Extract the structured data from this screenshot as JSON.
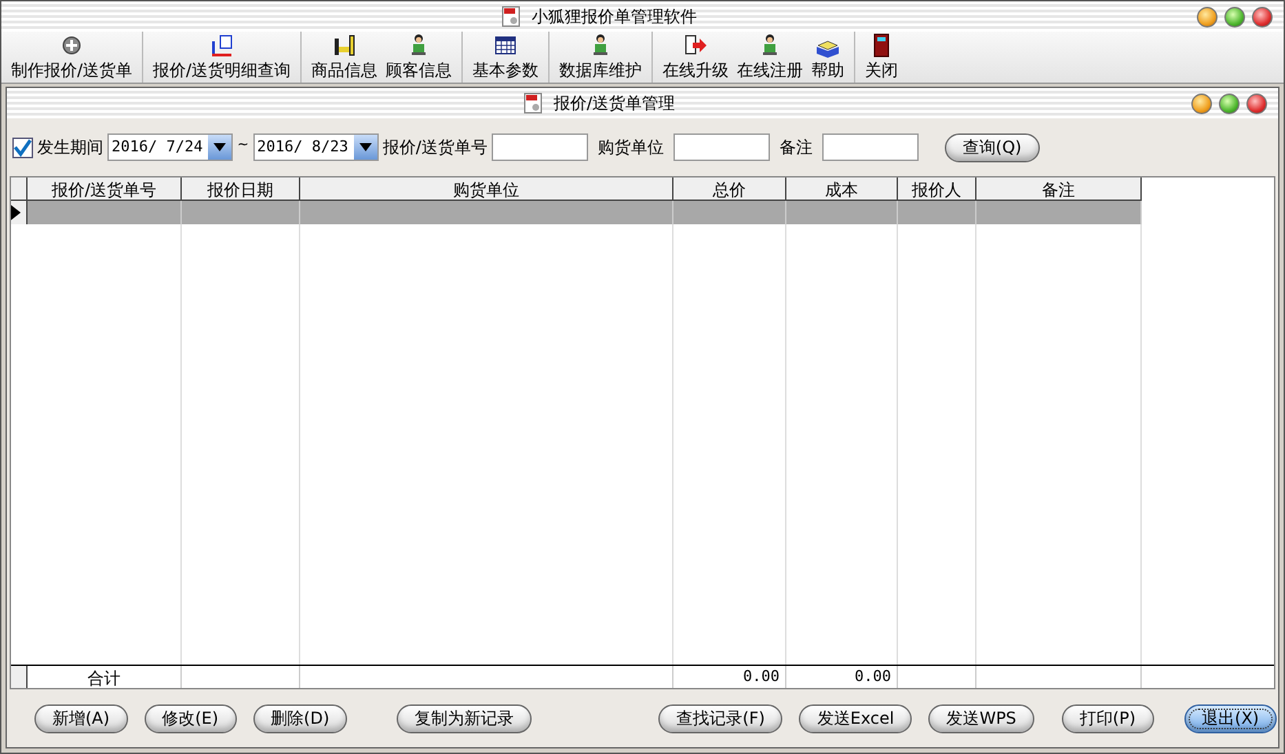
{
  "window": {
    "title": "小狐狸报价单管理软件"
  },
  "toolbar": [
    {
      "items": [
        "制作报价/送货单"
      ]
    },
    {
      "items": [
        "报价/送货明细查询"
      ]
    },
    {
      "items": [
        "商品信息",
        "顾客信息"
      ]
    },
    {
      "items": [
        "基本参数"
      ]
    },
    {
      "items": [
        "数据库维护"
      ]
    },
    {
      "items": [
        "在线升级",
        "在线注册",
        "帮助"
      ]
    },
    {
      "items": [
        "关闭"
      ]
    }
  ],
  "child_window": {
    "title": "报价/送货单管理"
  },
  "filter": {
    "period": {
      "label": "发生期间",
      "checked": true,
      "from": "2016/ 7/24",
      "separator": "~",
      "to": "2016/ 8/23"
    },
    "fields": [
      {
        "label": "报价/送货单号"
      },
      {
        "label": "购货单位"
      },
      {
        "label": "备注"
      }
    ],
    "search_button": "查询(Q)"
  },
  "table": {
    "columns": [
      "报价/送货单号",
      "报价日期",
      "购货单位",
      "总价",
      "成本",
      "报价人",
      "备注"
    ],
    "rows": [
      {
        "selected": true
      }
    ],
    "totals": {
      "label": "合计",
      "total_price": "0.00",
      "cost": "0.00"
    }
  },
  "buttons": [
    {
      "label": "新增(A)",
      "focused": false
    },
    {
      "label": "修改(E)",
      "focused": false
    },
    {
      "label": "删除(D)",
      "focused": false
    },
    {
      "label": "复制为新记录",
      "focused": false
    },
    {
      "label": "查找记录(F)",
      "focused": false
    },
    {
      "label": "发送Excel",
      "focused": false
    },
    {
      "label": "发送WPS",
      "focused": false
    },
    {
      "label": "打印(P)",
      "focused": false
    },
    {
      "label": "退出(X)",
      "focused": true
    }
  ]
}
